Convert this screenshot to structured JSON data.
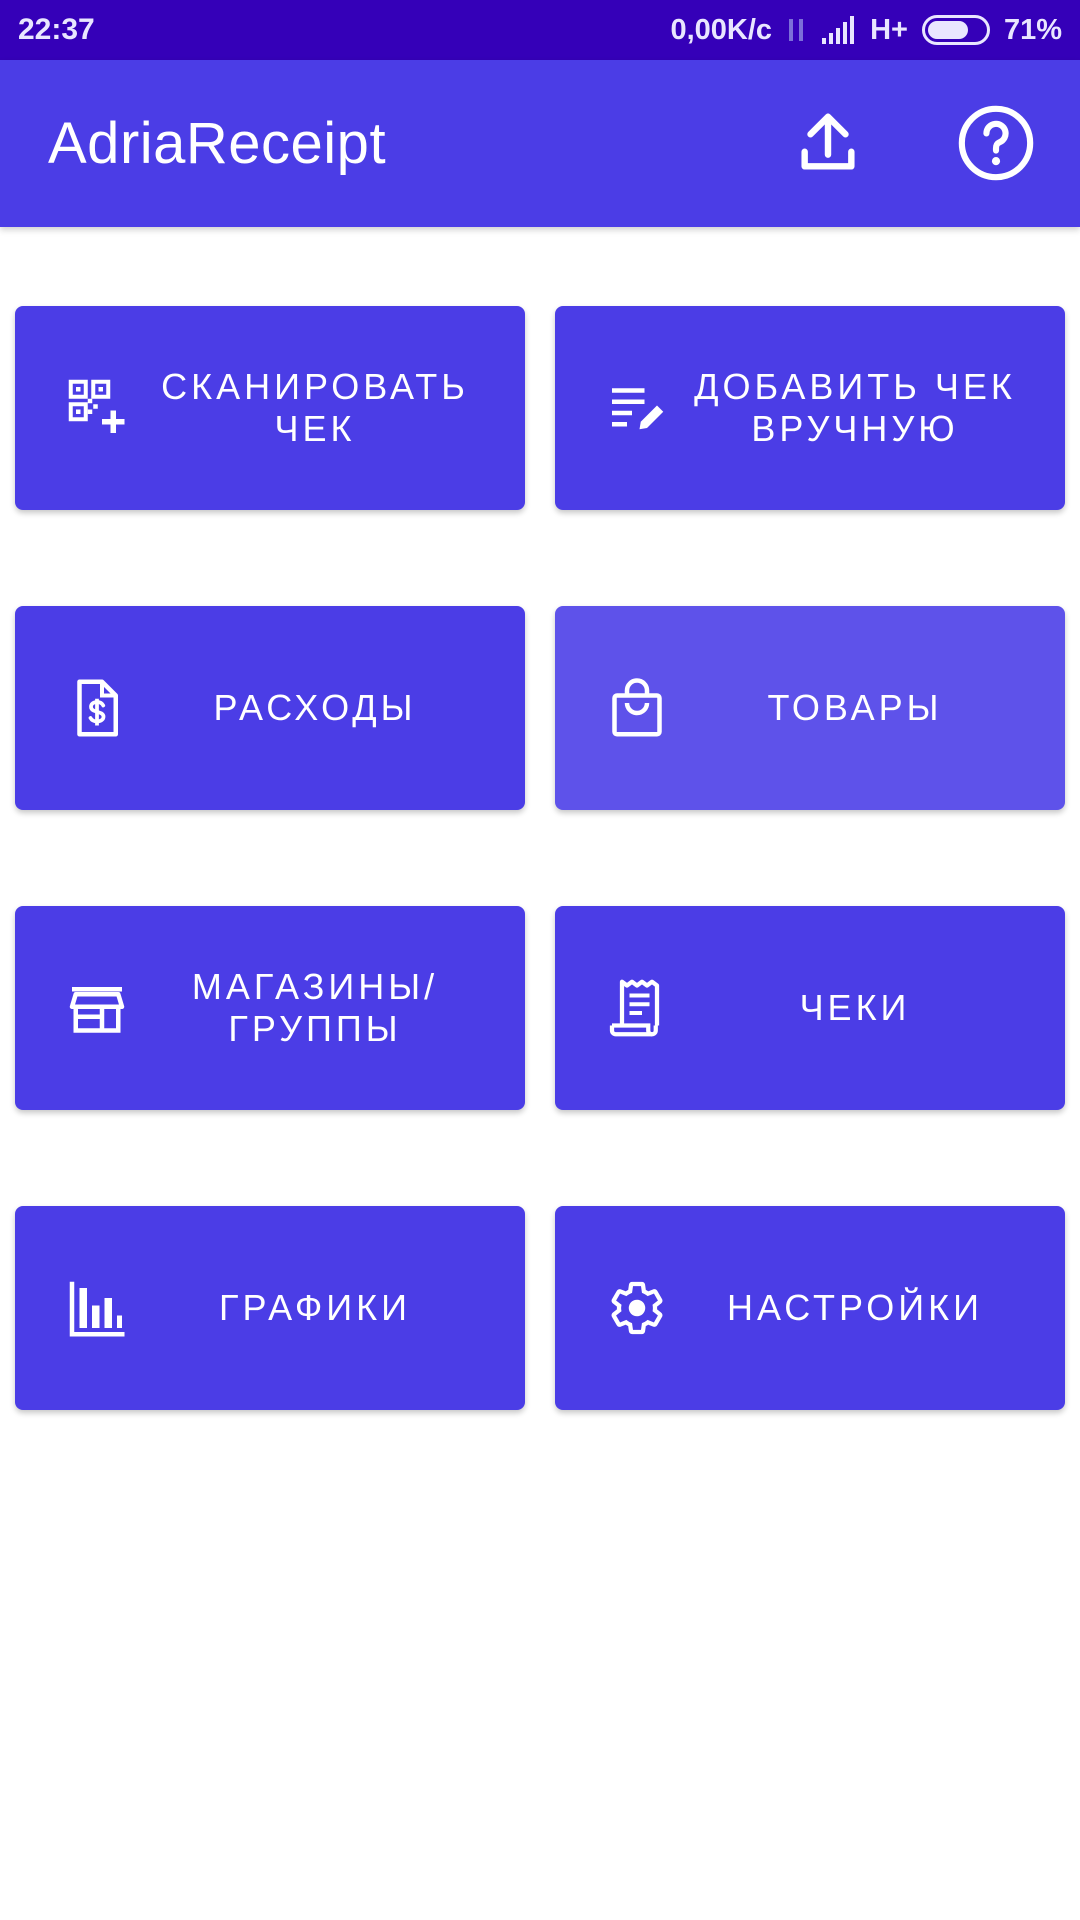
{
  "status_bar": {
    "time": "22:37",
    "net_speed": "0,00K/c",
    "network_type": "H+",
    "battery_percent": "71%",
    "battery_level": 0.71
  },
  "app_bar": {
    "title": "AdriaReceipt",
    "upload_icon": "upload-icon",
    "help_icon": "help-circle-icon"
  },
  "tiles": [
    {
      "label": "СКАНИРОВАТЬ\nЧЕК",
      "icon": "qr-add-icon"
    },
    {
      "label": "ДОБАВИТЬ ЧЕК\nВРУЧНУЮ",
      "icon": "edit-list-icon"
    },
    {
      "label": "РАСХОДЫ",
      "icon": "dollar-document-icon"
    },
    {
      "label": "ТОВАРЫ",
      "icon": "shopping-bag-icon"
    },
    {
      "label": "МАГАЗИНЫ/\nГРУППЫ",
      "icon": "store-icon"
    },
    {
      "label": "ЧЕКИ",
      "icon": "receipt-icon"
    },
    {
      "label": "ГРАФИКИ",
      "icon": "bar-chart-icon"
    },
    {
      "label": "НАСТРОЙКИ",
      "icon": "gear-icon"
    }
  ],
  "colors": {
    "status_bar": "#3500b8",
    "primary": "#4b3de6",
    "tile_pressed": "#5e52ea",
    "on_primary": "#ffffff"
  }
}
